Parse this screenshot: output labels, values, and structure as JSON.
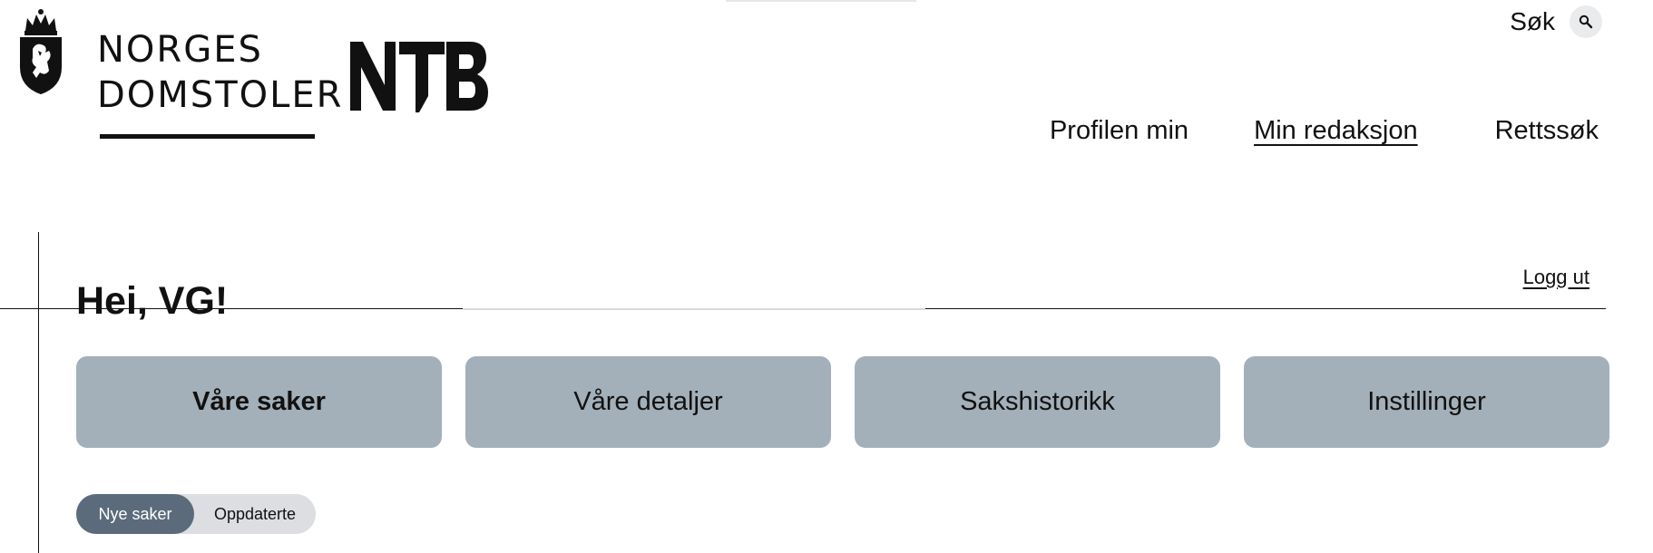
{
  "header": {
    "org_name_line1": "NORGES",
    "org_name_line2": "DOMSTOLER",
    "partner_logo": "NTB",
    "search_label": "Søk",
    "search_icon": "search-icon",
    "nav": [
      {
        "label": "Profilen min",
        "active": false
      },
      {
        "label": "Min redaksjon",
        "active": true
      },
      {
        "label": "Rettssøk",
        "active": false
      }
    ]
  },
  "main": {
    "greeting": "Hei, VG!",
    "logout_label": "Logg ut",
    "tabs": [
      {
        "label": "Våre saker",
        "active": true
      },
      {
        "label": "Våre detaljer",
        "active": false
      },
      {
        "label": "Sakshistorikk",
        "active": false
      },
      {
        "label": "Instillinger",
        "active": false
      }
    ],
    "filter_toggle": [
      {
        "label": "Nye saker",
        "active": true
      },
      {
        "label": "Oppdaterte",
        "active": false
      }
    ]
  },
  "colors": {
    "tab_bg": "#a3afb9",
    "toggle_active_bg": "#5b6b7b",
    "toggle_bg": "#dcdee1",
    "text": "#111111"
  }
}
